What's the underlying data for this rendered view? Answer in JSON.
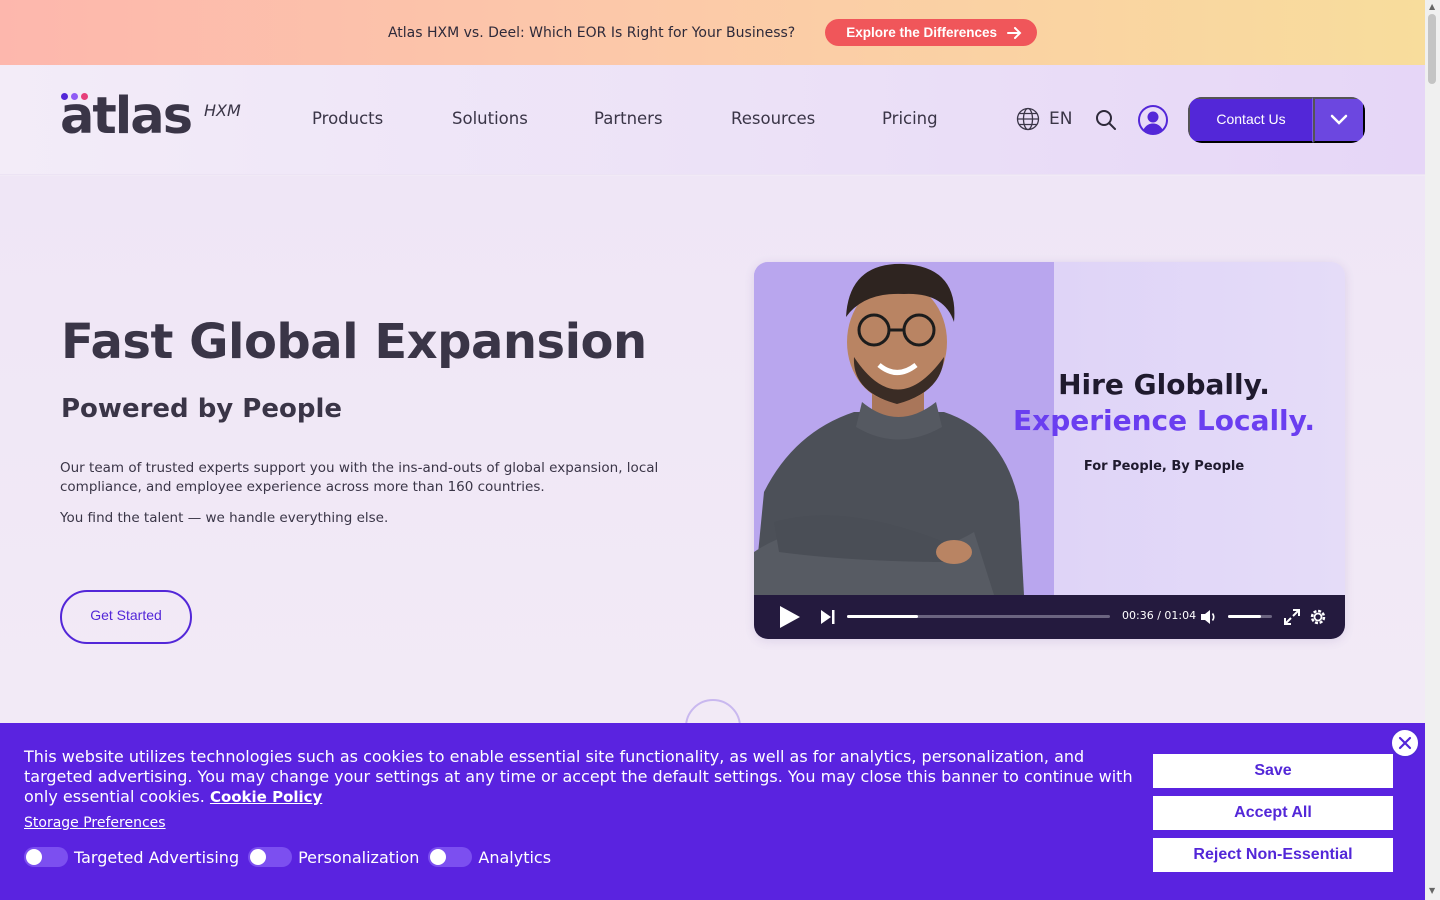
{
  "announcement": {
    "text": "Atlas HXM vs. Deel: Which EOR Is Right for Your Business?",
    "button_label": "Explore the Differences"
  },
  "header": {
    "logo": {
      "word": "atlas",
      "suffix": "HXM",
      "dot_colors": [
        "#5327d8",
        "#8f5cf5",
        "#e63f7a"
      ]
    },
    "nav": [
      "Products",
      "Solutions",
      "Partners",
      "Resources",
      "Pricing"
    ],
    "language": "EN",
    "contact_label": "Contact Us"
  },
  "hero": {
    "title": "Fast Global Expansion",
    "subtitle": "Powered by People",
    "paragraph1": "Our team of trusted experts support you with the ins-and-outs of global expansion, local compliance, and employee experience across more than 160 countries.",
    "paragraph2": "You find the talent — we handle everything else.",
    "cta_label": "Get Started"
  },
  "video": {
    "headline1": "Hire Globally.",
    "headline2": "Experience Locally.",
    "tagline": "For People, By People",
    "time": "00:36 / 01:04",
    "progress": 0.27,
    "volume": 0.75
  },
  "cookie_banner": {
    "text": "This website utilizes technologies such as cookies to enable essential site functionality, as well as for analytics, personalization, and targeted advertising. You may change your settings at any time or accept the default settings. You may close this banner to continue with only essential cookies.",
    "policy_link": "Cookie Policy",
    "preferences_link": "Storage Preferences",
    "toggles": [
      "Targeted Advertising",
      "Personalization",
      "Analytics"
    ],
    "buttons": {
      "save": "Save",
      "accept_all": "Accept All",
      "reject": "Reject Non-Essential"
    }
  },
  "colors": {
    "brand": "#5327d8",
    "cookie_bg": "#5a23e0",
    "announce_btn": "#f0565a"
  }
}
